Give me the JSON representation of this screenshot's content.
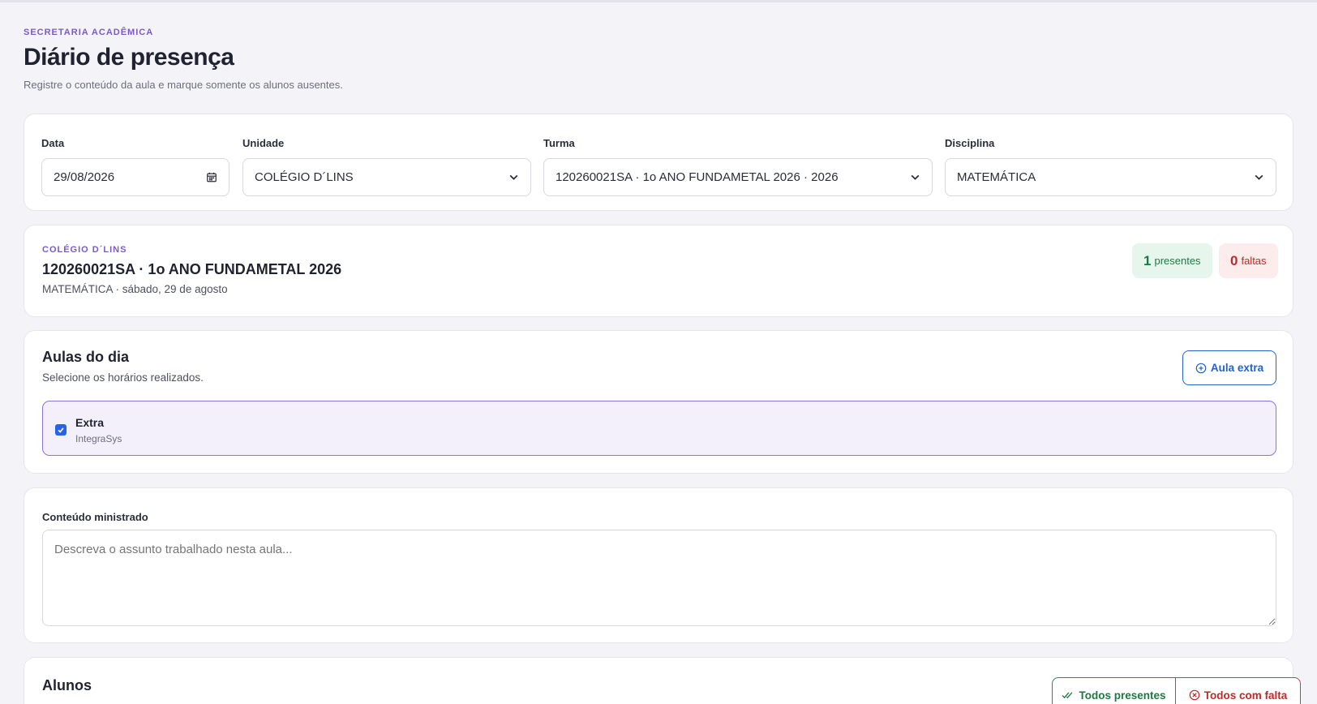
{
  "header": {
    "eyebrow": "SECRETARIA ACADÊMICA",
    "title": "Diário de presença",
    "subtitle": "Registre o conteúdo da aula e marque somente os alunos ausentes."
  },
  "filters": {
    "date": {
      "label": "Data",
      "value": "29/08/2026"
    },
    "unit": {
      "label": "Unidade",
      "value": "COLÉGIO D´LINS"
    },
    "class": {
      "label": "Turma",
      "value": "120260021SA · 1o ANO FUNDAMETAL 2026 · 2026"
    },
    "subject": {
      "label": "Disciplina",
      "value": "MATEMÁTICA"
    }
  },
  "summary": {
    "school": "COLÉGIO D´LINS",
    "class_title": "120260021SA · 1o ANO FUNDAMETAL 2026",
    "detail": "MATEMÁTICA · sábado, 29 de agosto",
    "present_count": "1",
    "present_label": "presentes",
    "absent_count": "0",
    "absent_label": "faltas"
  },
  "lessons": {
    "title": "Aulas do dia",
    "subtitle": "Selecione os horários realizados.",
    "extra_button": "Aula extra",
    "items": [
      {
        "name": "Extra",
        "source": "IntegraSys",
        "checked": true
      }
    ]
  },
  "content": {
    "label": "Conteúdo ministrado",
    "placeholder": "Descreva o assunto trabalhado nesta aula..."
  },
  "students": {
    "title": "Alunos",
    "all_present_button": "Todos presentes",
    "all_absent_button": "Todos com falta"
  },
  "colors": {
    "accent_purple": "#7b5ac8",
    "primary_blue": "#2563c9",
    "success_green": "#1c7a41",
    "danger_red": "#c12828",
    "background": "#f4f3f8"
  }
}
